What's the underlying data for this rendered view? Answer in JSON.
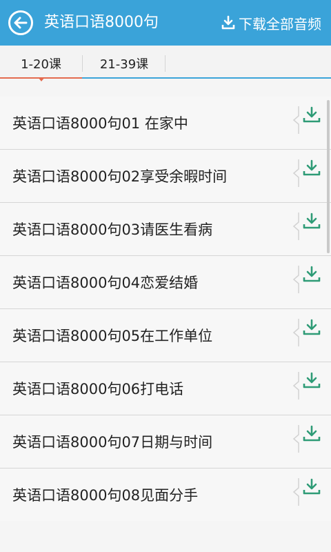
{
  "header": {
    "title": "英语口语8000句",
    "download_all_label": "下载全部音频",
    "back_icon": "back-arrow-icon",
    "download_icon": "download-icon"
  },
  "tabs": [
    {
      "label": "1-20课",
      "active": true
    },
    {
      "label": "21-39课",
      "active": false
    }
  ],
  "lessons": [
    {
      "label": "英语口语8000句01 在家中"
    },
    {
      "label": "英语口语8000句02享受余暇时间"
    },
    {
      "label": "英语口语8000句03请医生看病"
    },
    {
      "label": "英语口语8000句04恋爱结婚"
    },
    {
      "label": "英语口语8000句05在工作单位"
    },
    {
      "label": "英语口语8000句06打电话"
    },
    {
      "label": "英语口语8000句07日期与时间"
    },
    {
      "label": "英语口语8000句08见面分手"
    }
  ],
  "colors": {
    "header_bg": "#3aa3d9",
    "active_tab_indicator": "#e46a4e",
    "download_icon": "#2e9b76"
  }
}
